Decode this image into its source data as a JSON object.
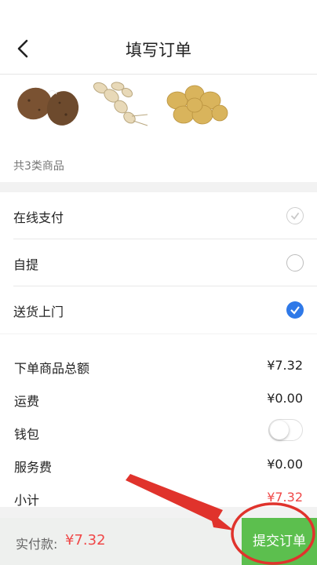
{
  "header": {
    "title": "填写订单"
  },
  "products": {
    "count_label": "共3类商品"
  },
  "payment": {
    "options": [
      {
        "label": "在线支付",
        "state": "grey-checked"
      },
      {
        "label": "自提",
        "state": "unchecked"
      },
      {
        "label": "送货上门",
        "state": "checked"
      }
    ]
  },
  "summary": {
    "rows": [
      {
        "label": "下单商品总额",
        "value": "¥7.32"
      },
      {
        "label": "运费",
        "value": "¥0.00"
      },
      {
        "label": "钱包",
        "value": ""
      },
      {
        "label": "服务费",
        "value": "¥0.00"
      },
      {
        "label": "小计",
        "value": "¥7.32"
      }
    ]
  },
  "footer": {
    "pay_label": "实付款:",
    "pay_amount": "¥7.32",
    "submit_label": "提交订单"
  },
  "colors": {
    "accent_green": "#5cbf4e",
    "price_red": "#f04848",
    "check_blue": "#2f79e8",
    "annotation_red": "#e0332c"
  }
}
